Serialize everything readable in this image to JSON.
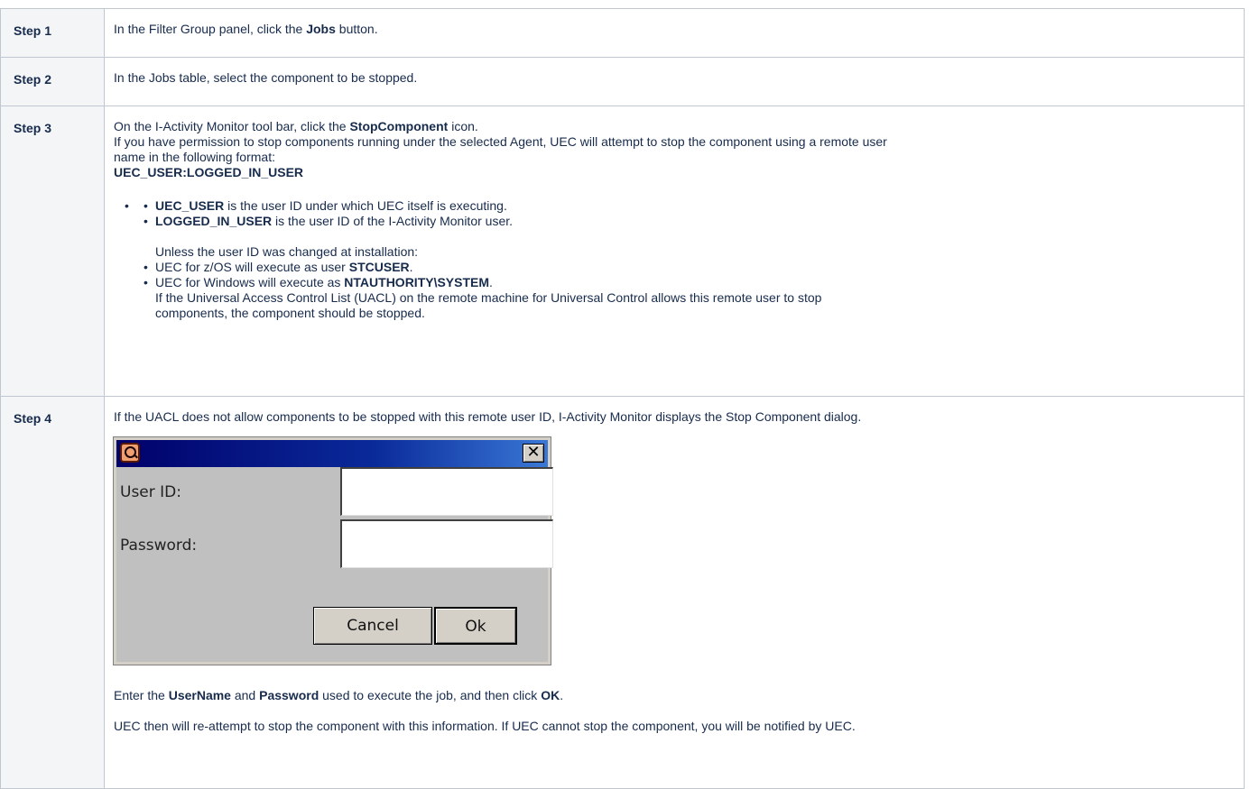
{
  "steps": [
    {
      "label": "Step 1",
      "text_before": "In the Filter Group panel, click the ",
      "bold": "Jobs",
      "text_after": " button."
    },
    {
      "label": "Step 2",
      "text": "In the Jobs table, select the component to be stopped."
    },
    {
      "label": "Step 3",
      "line1_before": "On the I-Activity Monitor tool bar, click the ",
      "line1_bold": "StopComponent",
      "line1_after": " icon.",
      "line2": "If you have permission to stop components running under the selected Agent, UEC will attempt to stop the component using a remote user",
      "line3": "name in the following format:",
      "format": "UEC_USER:LOGGED_IN_USER",
      "bullet1_bold": "UEC_USER",
      "bullet1_text": " is the user ID under which UEC itself is executing.",
      "bullet2_bold": "LOGGED_IN_USER",
      "bullet2_text": " is the user ID of the I-Activity Monitor user.",
      "unless": "Unless the user ID was changed at installation:",
      "bullet3_text": "UEC for z/OS will execute as user ",
      "bullet3_bold": "STCUSER",
      "bullet3_end": ".",
      "bullet4_text": "UEC for Windows will execute as ",
      "bullet4_bold": "NTAUTHORITY\\SYSTEM",
      "bullet4_end": ".",
      "uacl_line1": "If the Universal Access Control List (UACL) on the remote machine for Universal Control allows this remote user to stop",
      "uacl_line2": "components, the component should be stopped."
    },
    {
      "label": "Step 4",
      "intro": "If the UACL does not allow components to be stopped with this remote user ID, I-Activity Monitor displays the Stop Component dialog.",
      "enter_1": "Enter the ",
      "enter_bold1": "UserName",
      "enter_2": " and ",
      "enter_bold2": "Password",
      "enter_3": " used to execute the job, and then click ",
      "enter_bold3": "OK",
      "enter_4": ".",
      "retry": "UEC then will re-attempt to stop the component with this information. If UEC cannot stop the component, you will be notified by UEC."
    }
  ],
  "dialog": {
    "close_glyph": "✕",
    "user_id_label": "User ID:",
    "user_id_value": "",
    "password_label": "Password:",
    "password_value": "",
    "cancel_label": "Cancel",
    "ok_label": "Ok"
  },
  "bullet_glyph": "•"
}
